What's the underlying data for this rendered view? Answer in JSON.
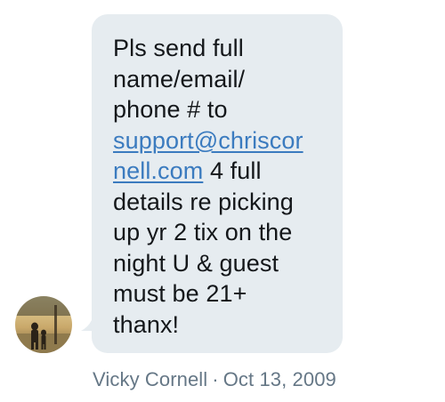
{
  "message": {
    "lines_before_link": [
      "Pls send full",
      "name/email/",
      "phone # to"
    ],
    "link_part1": "support@chriscor",
    "link_part2": "nell.com",
    "after_link_same_line": " 4 full",
    "lines_after_link": [
      "details re picking",
      "up yr 2 tix on the",
      "night U & guest",
      "must be 21+",
      "thanx!"
    ]
  },
  "meta": {
    "author": "Vicky Cornell",
    "separator": "·",
    "date": "Oct 13, 2009"
  },
  "colors": {
    "bubble": "#e6ecf0",
    "text": "#14171a",
    "link": "#3b7bbf",
    "meta": "#657786"
  },
  "icons": {
    "avatar": "user-avatar-photo"
  }
}
